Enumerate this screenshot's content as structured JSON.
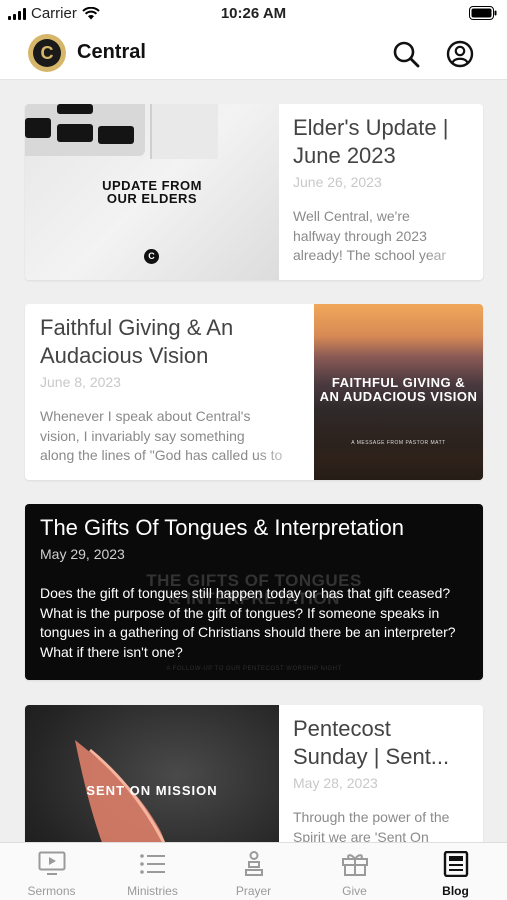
{
  "status_bar": {
    "carrier": "Carrier",
    "time": "10:26 AM"
  },
  "header": {
    "logo_letter": "C",
    "title": "Central"
  },
  "cards": [
    {
      "title": "Elder's Update | June 2023",
      "date": "June 26, 2023",
      "excerpt": [
        "Well Central, we're",
        "halfway through 2023",
        "already! The school year"
      ],
      "image_text": [
        "UPDATE FROM",
        "OUR ELDERS"
      ],
      "image_logo": "C"
    },
    {
      "title": "Faithful Giving & An Audacious Vision",
      "date": "June 8, 2023",
      "excerpt": [
        "Whenever I speak about Central's",
        "vision, I invariably say something",
        "along the lines of \"God has called us to"
      ],
      "image_text": [
        "FAITHFUL GIVING &",
        "AN AUDACIOUS VISION"
      ],
      "image_sub": "A MESSAGE FROM PASTOR MATT"
    },
    {
      "title": "The Gifts Of Tongues & Interpretation",
      "date": "May 29, 2023",
      "excerpt": "Does the gift of tongues still happen today or has that gift ceased? What is the purpose of the gift of tongues? If someone speaks in tongues in a gathering of Christians should there be an interpreter? What if there isn't one?",
      "image_text": [
        "THE GIFTS OF TONGUES",
        "& INTERPRETATION"
      ],
      "image_sub": "A FOLLOW-UP TO OUR PENTECOST WORSHIP NIGHT"
    },
    {
      "title": "Pentecost Sunday | Sent...",
      "date": "May 28, 2023",
      "excerpt": [
        "Through the power of the",
        "Spirit we are 'Sent On"
      ],
      "image_text": "SENT ON MISSION"
    }
  ],
  "tabs": [
    {
      "label": "Sermons",
      "icon": "tv-play-icon"
    },
    {
      "label": "Ministries",
      "icon": "list-icon"
    },
    {
      "label": "Prayer",
      "icon": "prayer-icon"
    },
    {
      "label": "Give",
      "icon": "gift-icon"
    },
    {
      "label": "Blog",
      "icon": "blog-icon",
      "active": true
    }
  ]
}
